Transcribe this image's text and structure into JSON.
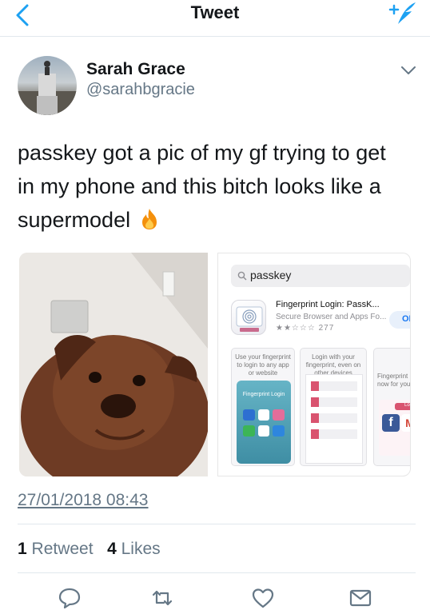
{
  "nav": {
    "title": "Tweet"
  },
  "author": {
    "name": "Sarah Grace",
    "handle": "@sarahbgracie"
  },
  "tweet": {
    "line1": "passkey got a pic of my gf trying to get",
    "line2": "in my phone and this bitch looks like a",
    "line3": "supermodel",
    "emoji": "fire-icon"
  },
  "media": {
    "app_store": {
      "search_query": "passkey",
      "app_name": "Fingerprint Login: PassK...",
      "app_subtitle": "Secure Browser and Apps Fo...",
      "rating_count": "277",
      "get_label": "OI",
      "shot1_caption": "Use your fingerprint to login to any app or website",
      "shot2_caption": "Login with your fingerprint, even on other devices",
      "shot3_caption": "Fingerprint now for your c",
      "shot1_app_label": "Fingerprint Login",
      "shot3_app_label": "Logi"
    }
  },
  "timestamp": "27/01/2018 08:43",
  "stats": {
    "retweets_count": "1",
    "retweets_label": "Retweet",
    "likes_count": "4",
    "likes_label": "Likes"
  },
  "colors": {
    "accent": "#1da1f2",
    "secondary_text": "#657786",
    "divider": "#e1e8ed"
  }
}
